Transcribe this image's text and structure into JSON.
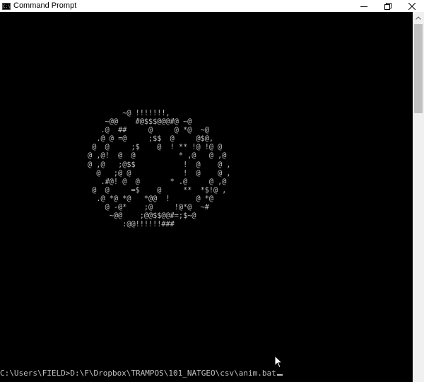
{
  "window": {
    "title": "Command Prompt",
    "icon_label": "C:\\",
    "controls": [
      "minimize-icon",
      "restore-icon",
      "close-icon"
    ]
  },
  "console": {
    "ascii_art": "         ~@ !!!!!!!,\n     ~@@    #@$$$@@@#@ ~@\n    .@  ##     @     @ *@  ~@\n   .@ @ =@     ;$$  @     @$@,\n  @  @     ;$    @  ! ** !@ !@ @\n @ ,@!  @  @          * ,@   @ ,@\n @ ,@   ;@$$           !  @    @ ,\n   @   ;@ @            !  @    @ ,\n    .#@! @  @       * .@     @ ,@\n  @  @     =$    @     **  *$!@ ,\n   .@ *@ *@   *@@  !      @ *@\n     @ -@*    ;@     !@*@  ~#\n      ~@@    ;@@$$@@#=;$~@\n         :@@!!!!!!###",
    "prompt_text": "C:\\Users\\FIELD>D:\\F\\Dropbox\\TRAMPOS\\101_NATGEO\\csv\\anim.bat"
  },
  "colors": {
    "console_bg": "#000000",
    "console_text": "#c0c0c0",
    "titlebar_bg": "#ffffff",
    "scrollbar_track": "#f0f0f0",
    "scrollbar_thumb": "#c1c1c1"
  }
}
